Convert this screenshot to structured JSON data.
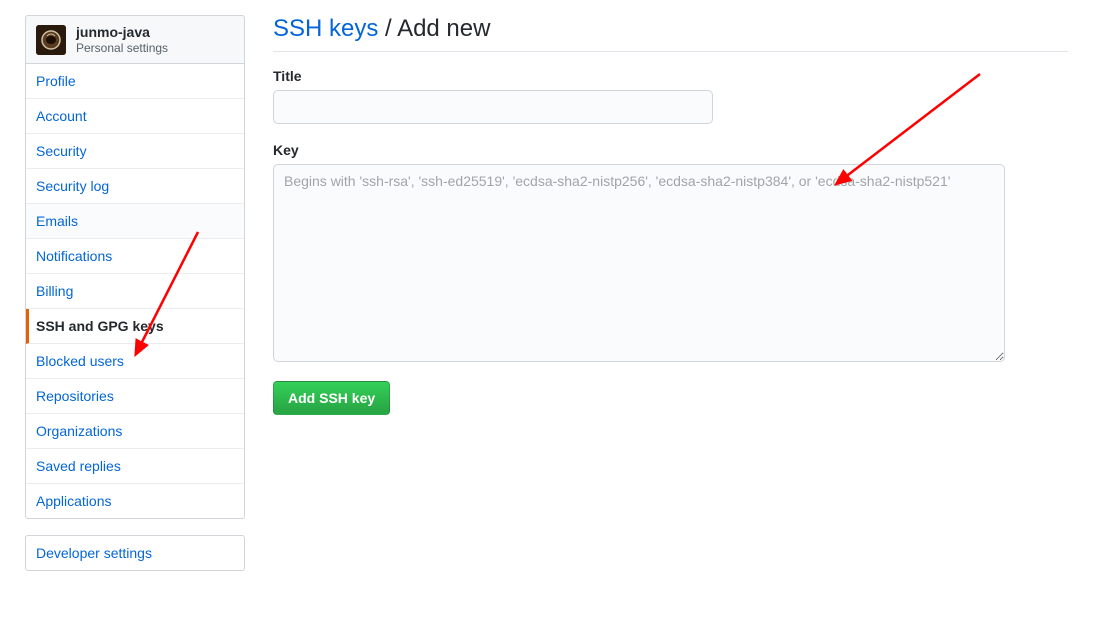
{
  "profile": {
    "name": "junmo-java",
    "subtitle": "Personal settings"
  },
  "sidebar": {
    "items": [
      {
        "label": "Profile"
      },
      {
        "label": "Account"
      },
      {
        "label": "Security"
      },
      {
        "label": "Security log"
      },
      {
        "label": "Emails"
      },
      {
        "label": "Notifications"
      },
      {
        "label": "Billing"
      },
      {
        "label": "SSH and GPG keys"
      },
      {
        "label": "Blocked users"
      },
      {
        "label": "Repositories"
      },
      {
        "label": "Organizations"
      },
      {
        "label": "Saved replies"
      },
      {
        "label": "Applications"
      }
    ],
    "active_index": 7,
    "developer_settings": "Developer settings"
  },
  "page": {
    "breadcrumb_link": "SSH keys",
    "breadcrumb_sep": " / ",
    "breadcrumb_current": "Add new"
  },
  "form": {
    "title_label": "Title",
    "title_value": "",
    "key_label": "Key",
    "key_value": "",
    "key_placeholder": "Begins with 'ssh-rsa', 'ssh-ed25519', 'ecdsa-sha2-nistp256', 'ecdsa-sha2-nistp384', or 'ecdsa-sha2-nistp521'",
    "submit_label": "Add SSH key"
  },
  "annotations": {
    "arrow_color": "#ff0000"
  }
}
